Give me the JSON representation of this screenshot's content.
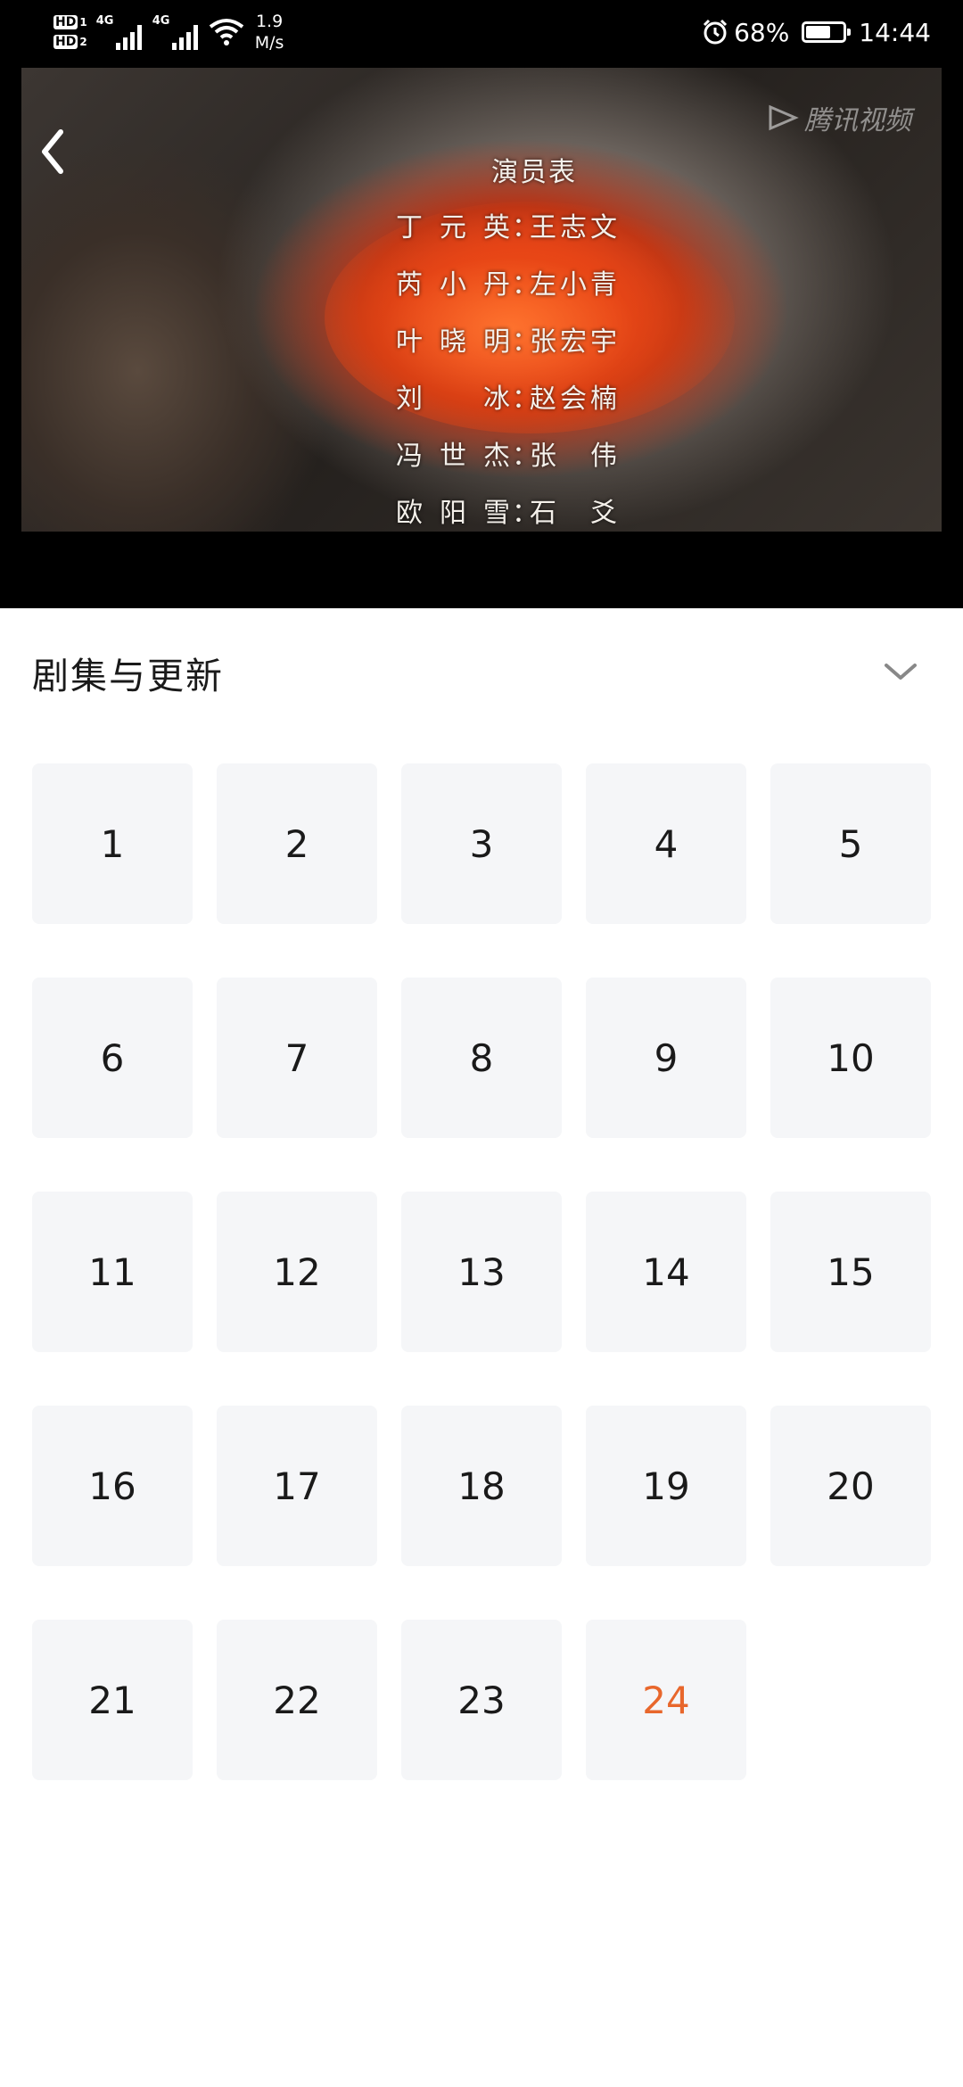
{
  "status_bar": {
    "hd1": "HD",
    "hd1_sub": "1",
    "hd2": "HD",
    "hd2_sub": "2",
    "sig1_label": "4G",
    "sig2_label": "4G",
    "speed_value": "1.9",
    "speed_unit": "M/s",
    "battery_pct": "68%",
    "battery_level": 0.68,
    "time": "14:44",
    "icons": [
      "alarm-icon",
      "battery-icon",
      "wifi-icon",
      "signal-icon"
    ]
  },
  "video": {
    "watermark": "腾讯视频",
    "credits": {
      "title": "演员表",
      "rows": [
        {
          "role": "丁元英",
          "actor": "王志文"
        },
        {
          "role": "芮小丹",
          "actor": "左小青"
        },
        {
          "role": "叶晓明",
          "actor": "张宏宇"
        },
        {
          "role": "刘　冰",
          "actor": "赵会楠"
        },
        {
          "role": "冯世杰",
          "actor": "张　伟"
        },
        {
          "role": "欧阳雪",
          "actor": "石　爻"
        }
      ],
      "separator": "："
    }
  },
  "panel": {
    "title": "剧集与更新",
    "current_episode": "24",
    "accent_color": "#e8672c",
    "episodes": [
      "1",
      "2",
      "3",
      "4",
      "5",
      "6",
      "7",
      "8",
      "9",
      "10",
      "11",
      "12",
      "13",
      "14",
      "15",
      "16",
      "17",
      "18",
      "19",
      "20",
      "21",
      "22",
      "23",
      "24"
    ]
  }
}
